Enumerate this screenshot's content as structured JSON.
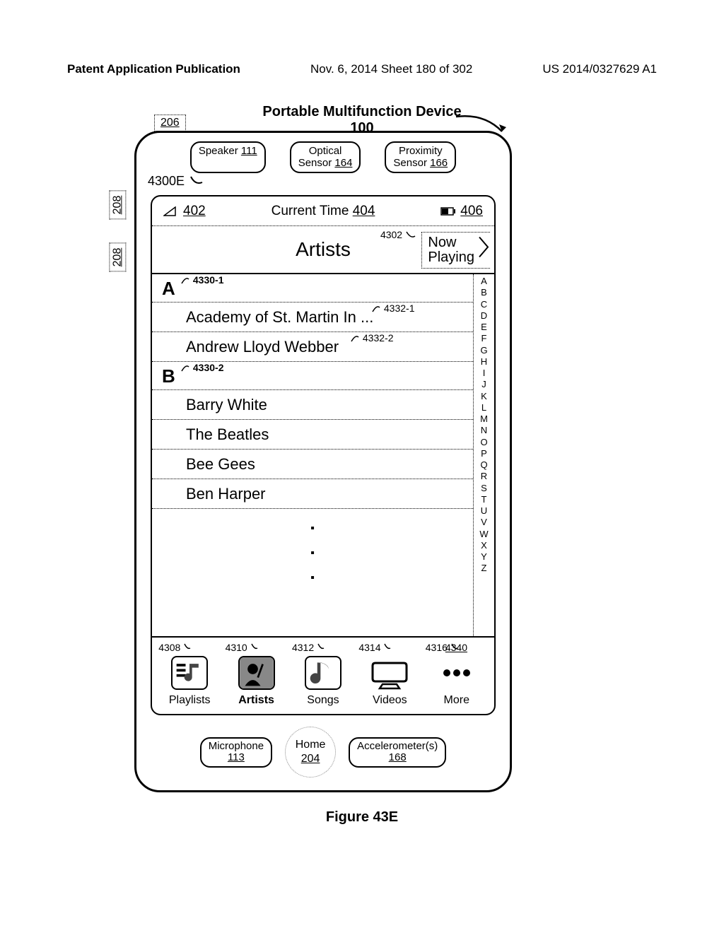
{
  "header": {
    "publication": "Patent Application Publication",
    "date_sheet": "Nov. 6, 2014  Sheet 180 of 302",
    "pubno": "US 2014/0327629 A1"
  },
  "figure_caption": "Figure 43E",
  "device": {
    "title": "Portable Multifunction Device",
    "title_ref": "100",
    "ref_206": "206",
    "ref_208": "208",
    "ref_4300E": "4300E",
    "sensors": {
      "speaker": {
        "label": "Speaker",
        "ref": "111"
      },
      "optical": {
        "label1": "Optical",
        "label2": "Sensor",
        "ref": "164"
      },
      "proximity": {
        "label1": "Proximity",
        "label2": "Sensor",
        "ref": "166"
      }
    },
    "status_bar": {
      "ref_402": "402",
      "current_time": "Current Time",
      "ref_404": "404",
      "ref_406": "406"
    },
    "title_bar": {
      "title": "Artists",
      "ref_4302": "4302",
      "now1": "Now",
      "now2": "Playing"
    },
    "sections": [
      {
        "letter": "A",
        "ref": "4330-1"
      },
      {
        "letter": "B",
        "ref": "4330-2"
      }
    ],
    "rows_a": [
      {
        "text": "Academy of St. Martin In ...",
        "ref": "4332-1"
      },
      {
        "text": "Andrew Lloyd Webber",
        "ref": "4332-2"
      }
    ],
    "rows_b": [
      {
        "text": "Barry White"
      },
      {
        "text": "The Beatles"
      },
      {
        "text": "Bee Gees"
      },
      {
        "text": "Ben Harper"
      }
    ],
    "index_letters": [
      "A",
      "B",
      "C",
      "D",
      "E",
      "F",
      "G",
      "H",
      "I",
      "J",
      "K",
      "L",
      "M",
      "N",
      "O",
      "P",
      "Q",
      "R",
      "S",
      "T",
      "U",
      "V",
      "W",
      "X",
      "Y",
      "Z"
    ],
    "tabs": {
      "playlists": {
        "label": "Playlists",
        "ref": "4308"
      },
      "artists": {
        "label": "Artists",
        "ref": "4310"
      },
      "songs": {
        "label": "Songs",
        "ref": "4312"
      },
      "videos": {
        "label": "Videos",
        "ref": "4314"
      },
      "more": {
        "label": "More",
        "ref": "4316"
      },
      "ref_4340": "4340"
    },
    "bottom": {
      "mic": {
        "label": "Microphone",
        "ref": "113"
      },
      "home": {
        "label": "Home",
        "ref": "204"
      },
      "accel": {
        "label": "Accelerometer(s)",
        "ref": "168"
      }
    }
  }
}
